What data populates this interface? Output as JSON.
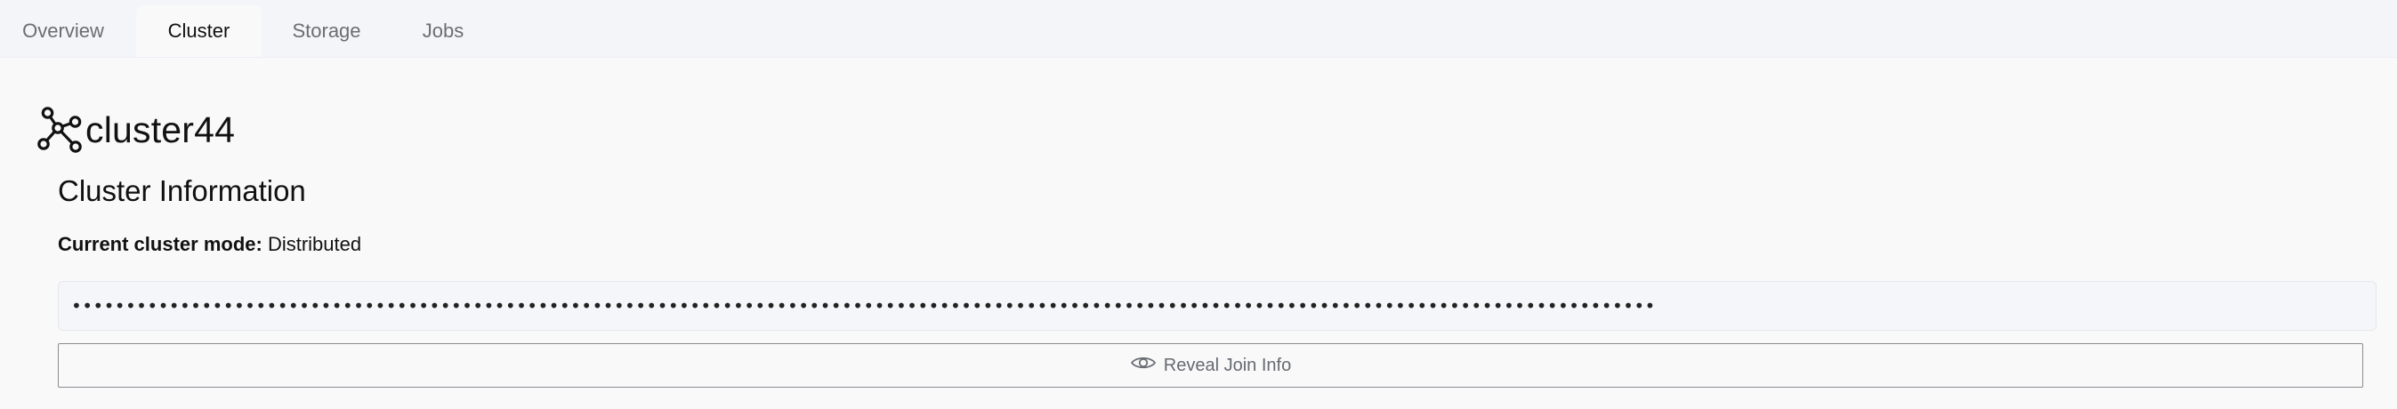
{
  "tabs": [
    {
      "label": "Overview",
      "active": false
    },
    {
      "label": "Cluster",
      "active": true
    },
    {
      "label": "Storage",
      "active": false
    },
    {
      "label": "Jobs",
      "active": false
    }
  ],
  "cluster": {
    "icon": "network-nodes-icon",
    "name": "cluster44"
  },
  "info": {
    "title": "Cluster Information",
    "mode_label": "Current cluster mode:",
    "mode_value": "Distributed",
    "join_info_masked": "••••••••••••••••••••••••••••••••••••••••••••••••••••••••••••••••••••••••••••••••••••••••••••••••••••••••••••••••••••••••••••••••••••••••••••••••••"
  },
  "reveal_button": {
    "icon": "eye-icon",
    "label": "Reveal Join Info"
  },
  "colors": {
    "tabbar_bg": "#f4f5f9",
    "page_bg": "#f9f9fa",
    "muted_text": "#6a6d73",
    "button_border": "#8b8d91"
  }
}
